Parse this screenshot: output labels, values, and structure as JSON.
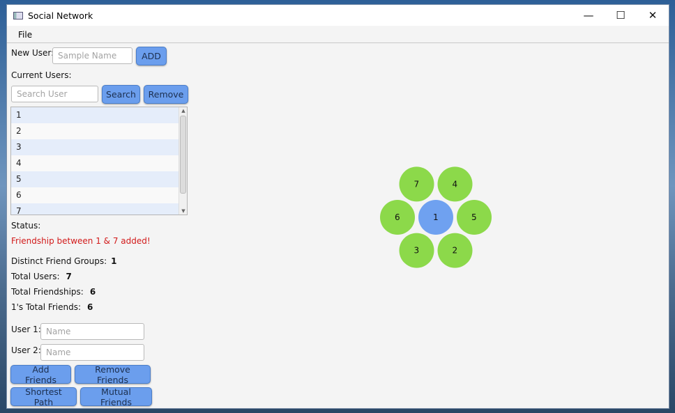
{
  "window": {
    "title": "Social Network",
    "minimize": "—",
    "maximize": "☐",
    "close": "✕"
  },
  "menu": {
    "file": "File"
  },
  "new_user": {
    "label": "New User:",
    "placeholder": "Sample Name",
    "add_label": "ADD"
  },
  "current_users": {
    "label": "Current Users:",
    "search_placeholder": "Search User",
    "search_label": "Search",
    "remove_label": "Remove",
    "items": [
      "1",
      "2",
      "3",
      "4",
      "5",
      "6",
      "7"
    ]
  },
  "status": {
    "label": "Status:",
    "message": "Friendship between 1 & 7 added!",
    "message_color": "#d21a1a"
  },
  "stats": {
    "groups_label": "Distinct Friend Groups:",
    "groups_value": "1",
    "users_label": "Total Users:",
    "users_value": "7",
    "friendships_label": "Total Friendships:",
    "friendships_value": "6",
    "friends_label": "1's Total Friends:",
    "friends_value": "6"
  },
  "user1": {
    "label": "User 1:",
    "placeholder": "Name"
  },
  "user2": {
    "label": "User 2:",
    "placeholder": "Name"
  },
  "actions": {
    "add_friends": "Add Friends",
    "remove_friends": "Remove Friends",
    "shortest_path": "Shortest Path",
    "mutual_friends": "Mutual Friends"
  },
  "graph": {
    "center_color": "#6fa1f0",
    "friend_color": "#8cd94a",
    "center": "1",
    "friends": [
      "2",
      "3",
      "6",
      "7",
      "4",
      "5"
    ]
  }
}
